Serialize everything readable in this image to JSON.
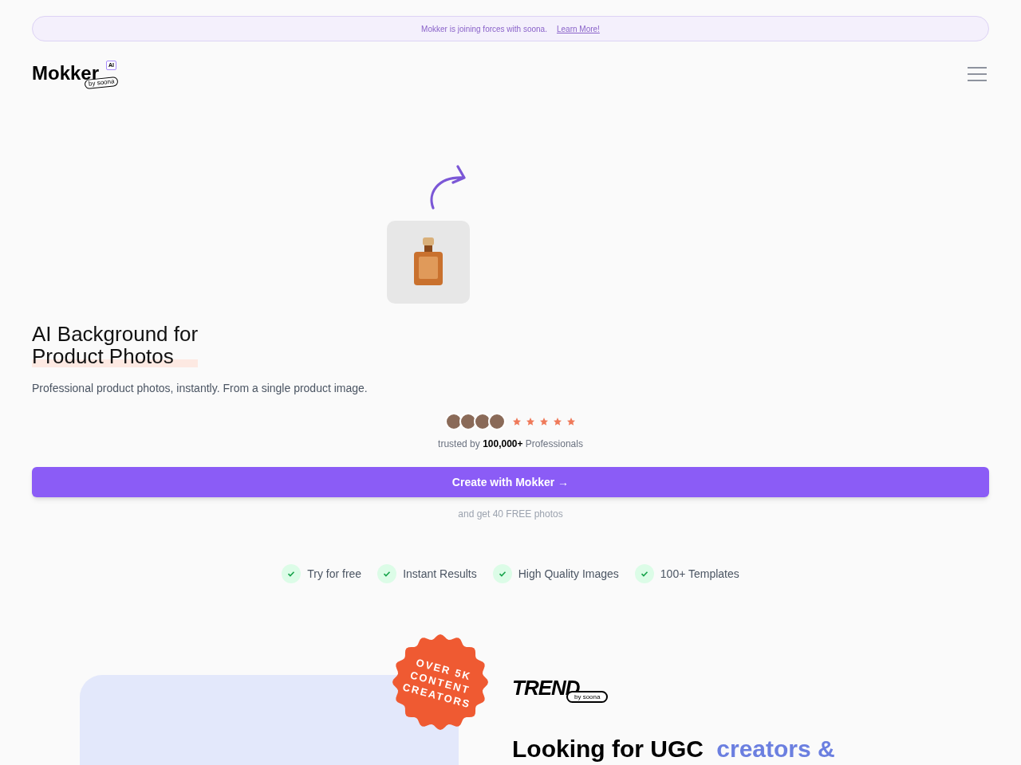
{
  "banner": {
    "text": "Mokker is joining forces with soona.",
    "link": "Learn More!"
  },
  "logo": {
    "wordmark": "Mokker",
    "tag": "AI",
    "byline": "by soona"
  },
  "hero": {
    "title_lines": [
      "AI Background for",
      "Product Photos"
    ],
    "subtitle": "Professional product photos, instantly. From a single product image.",
    "rating": {
      "stars": 5,
      "prefix": "trusted by",
      "count": "100,000+",
      "suffix": "Professionals"
    },
    "cta": "Create with Mokker →",
    "cta_note": "and get 40 FREE photos"
  },
  "features": [
    {
      "label": "Try for free"
    },
    {
      "label": "Instant Results"
    },
    {
      "label": "High Quality Images"
    },
    {
      "label": "100+ Templates"
    }
  ],
  "promo": {
    "badge_lines": [
      "OVER 5K",
      "CONTENT",
      "CREATORS"
    ],
    "brand": "TREND",
    "brand_byline": "by soona",
    "heading": "Looking for UGC",
    "heading_accent": "creators &"
  }
}
